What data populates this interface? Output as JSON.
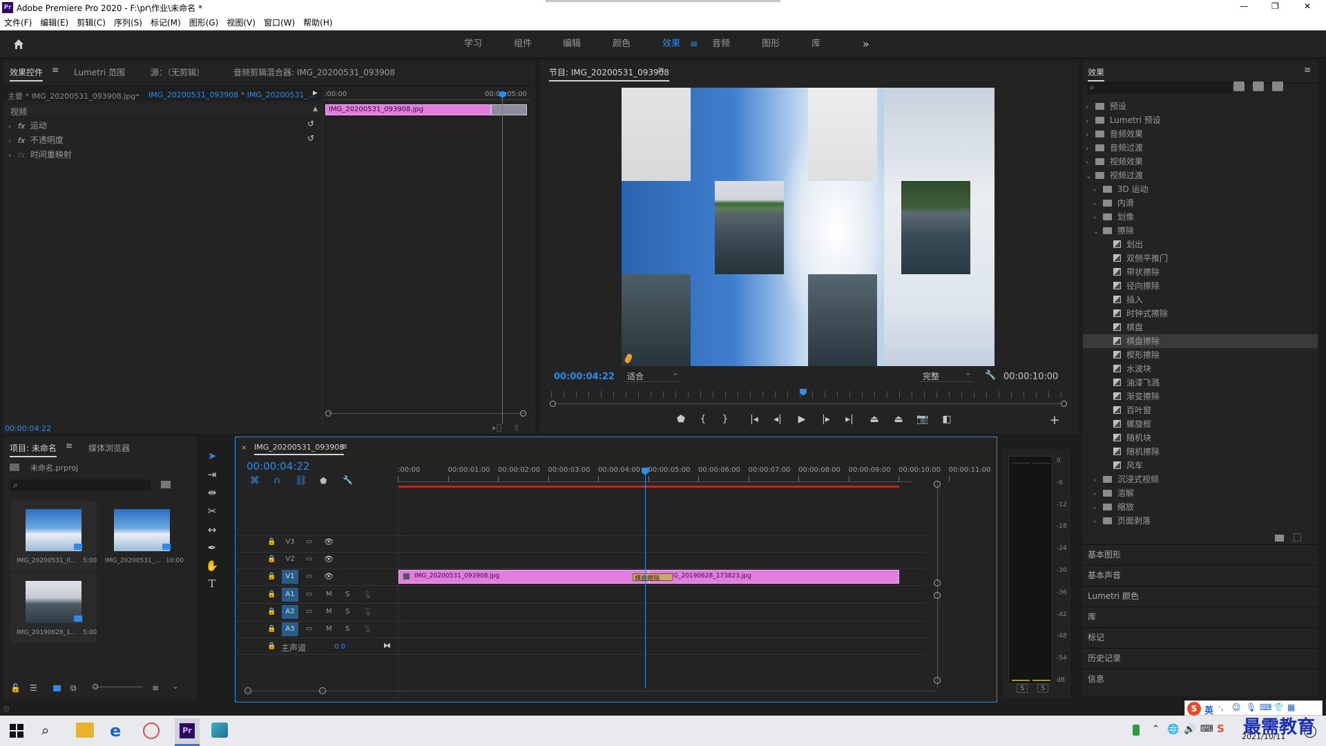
{
  "window": {
    "title": "Adobe Premiere Pro 2020 - F:\\pr\\作业\\未命名 *",
    "controls": [
      "—",
      "❐",
      "✕"
    ]
  },
  "menu": [
    "文件(F)",
    "编辑(E)",
    "剪辑(C)",
    "序列(S)",
    "标记(M)",
    "图形(G)",
    "视图(V)",
    "窗口(W)",
    "帮助(H)"
  ],
  "workspaces": {
    "items": [
      "学习",
      "组件",
      "编辑",
      "颜色",
      "效果",
      "音频",
      "图形",
      "库"
    ],
    "active": "效果",
    "more": "»"
  },
  "effect_controls": {
    "tabs": [
      "效果控件",
      "Lumetri 范围",
      "源：（无剪辑）",
      "音频剪辑混合器: IMG_20200531_093908"
    ],
    "master_clip": "主要 * IMG_20200531_093908.jpg",
    "sequence_clip": "IMG_20200531_093908 * IMG_20200531_...",
    "ruler_start": ":00:00",
    "ruler_end": "00:00:05:00",
    "clip_name": "IMG_20200531_093908.jpg",
    "section": "视频",
    "effects": [
      {
        "fx": "fx",
        "name": "运动"
      },
      {
        "fx": "fx",
        "name": "不透明度"
      },
      {
        "fx": "fx",
        "name": "时间重映射"
      }
    ],
    "timecode": "00:00:04:22"
  },
  "program": {
    "title": "节目: IMG_20200531_093908",
    "timecode": "00:00:04:22",
    "fit": "适合",
    "quality": "完整",
    "duration": "00:00:10:00",
    "playhead_fraction": 0.49
  },
  "effects_panel": {
    "title": "效果",
    "search_placeholder": "",
    "tree": [
      {
        "level": 0,
        "type": "folder",
        "label": "预设",
        "open": false
      },
      {
        "level": 0,
        "type": "folder",
        "label": "Lumetri 预设",
        "open": false
      },
      {
        "level": 0,
        "type": "folder",
        "label": "音频效果",
        "open": false
      },
      {
        "level": 0,
        "type": "folder",
        "label": "音频过渡",
        "open": false
      },
      {
        "level": 0,
        "type": "folder",
        "label": "视频效果",
        "open": false
      },
      {
        "level": 0,
        "type": "folder",
        "label": "视频过渡",
        "open": true
      },
      {
        "level": 1,
        "type": "folder",
        "label": "3D 运动",
        "open": false
      },
      {
        "level": 1,
        "type": "folder",
        "label": "内滑",
        "open": false
      },
      {
        "level": 1,
        "type": "folder",
        "label": "划像",
        "open": false
      },
      {
        "level": 1,
        "type": "folder",
        "label": "擦除",
        "open": true
      },
      {
        "level": 2,
        "type": "fx",
        "label": "划出"
      },
      {
        "level": 2,
        "type": "fx",
        "label": "双侧平推门"
      },
      {
        "level": 2,
        "type": "fx",
        "label": "带状擦除"
      },
      {
        "level": 2,
        "type": "fx",
        "label": "径向擦除"
      },
      {
        "level": 2,
        "type": "fx",
        "label": "插入"
      },
      {
        "level": 2,
        "type": "fx",
        "label": "时钟式擦除"
      },
      {
        "level": 2,
        "type": "fx",
        "label": "棋盘"
      },
      {
        "level": 2,
        "type": "fx",
        "label": "棋盘擦除",
        "selected": true
      },
      {
        "level": 2,
        "type": "fx",
        "label": "楔形擦除"
      },
      {
        "level": 2,
        "type": "fx",
        "label": "水波块"
      },
      {
        "level": 2,
        "type": "fx",
        "label": "油漆飞溅"
      },
      {
        "level": 2,
        "type": "fx",
        "label": "渐变擦除"
      },
      {
        "level": 2,
        "type": "fx",
        "label": "百叶窗"
      },
      {
        "level": 2,
        "type": "fx",
        "label": "螺旋框"
      },
      {
        "level": 2,
        "type": "fx",
        "label": "随机块"
      },
      {
        "level": 2,
        "type": "fx",
        "label": "随机擦除"
      },
      {
        "level": 2,
        "type": "fx",
        "label": "风车"
      },
      {
        "level": 1,
        "type": "folder",
        "label": "沉浸式视频",
        "open": false
      },
      {
        "level": 1,
        "type": "folder",
        "label": "溶解",
        "open": false
      },
      {
        "level": 1,
        "type": "folder",
        "label": "缩放",
        "open": false
      },
      {
        "level": 1,
        "type": "folder",
        "label": "页面剥落",
        "open": false
      }
    ],
    "collapsed_panels": [
      "基本图形",
      "基本声音",
      "Lumetri 颜色",
      "库",
      "标记",
      "历史记录",
      "信息"
    ]
  },
  "project": {
    "tabs": [
      "项目: 未命名",
      "媒体浏览器"
    ],
    "file": "未命名.prproj",
    "items": [
      {
        "name": "IMG_20200531_0...",
        "duration": "5:00",
        "kind": "sky"
      },
      {
        "name": "IMG_20200531_...",
        "duration": "10:00",
        "kind": "sky"
      },
      {
        "name": "IMG_20190628_1...",
        "duration": "5:00",
        "kind": "lake"
      }
    ]
  },
  "timeline": {
    "title": "IMG_20200531_093908",
    "timecode": "00:00:04:22",
    "ruler": [
      ":00:00",
      "00:00:01:00",
      "00:00:02:00",
      "00:00:03:00",
      "00:00:04:00",
      "00:00:05:00",
      "00:00:06:00",
      "00:00:07:00",
      "00:00:08:00",
      "00:00:09:00",
      "00:00:10:00",
      "00:00:11:00"
    ],
    "video_tracks": [
      "V3",
      "V2",
      "V1"
    ],
    "audio_tracks": [
      "A1",
      "A2",
      "A3"
    ],
    "audio_btns": [
      "M",
      "S"
    ],
    "master": {
      "label": "主声道",
      "value": "0.0"
    },
    "clips": [
      {
        "name": "IMG_20200531_093908.jpg",
        "start": 0,
        "end": 5
      },
      {
        "name": "IMG_20190628_173823.jpg",
        "start": 5,
        "end": 10
      }
    ],
    "transition": "棋盘擦除",
    "playhead_seconds": 4.92
  },
  "meter": {
    "scale": [
      "0",
      "-6",
      "-12",
      "-18",
      "-24",
      "-30",
      "-36",
      "-42",
      "-48",
      "-54",
      "dB"
    ],
    "buttons": [
      "S",
      "S"
    ]
  },
  "taskbar": {
    "date": "2021/10/11",
    "ime": "英",
    "watermark": "最需教育"
  },
  "colors": {
    "accent": "#2d8ceb",
    "clip": "#e07ddf",
    "transition": "#c9a66b",
    "panel": "#232323"
  }
}
